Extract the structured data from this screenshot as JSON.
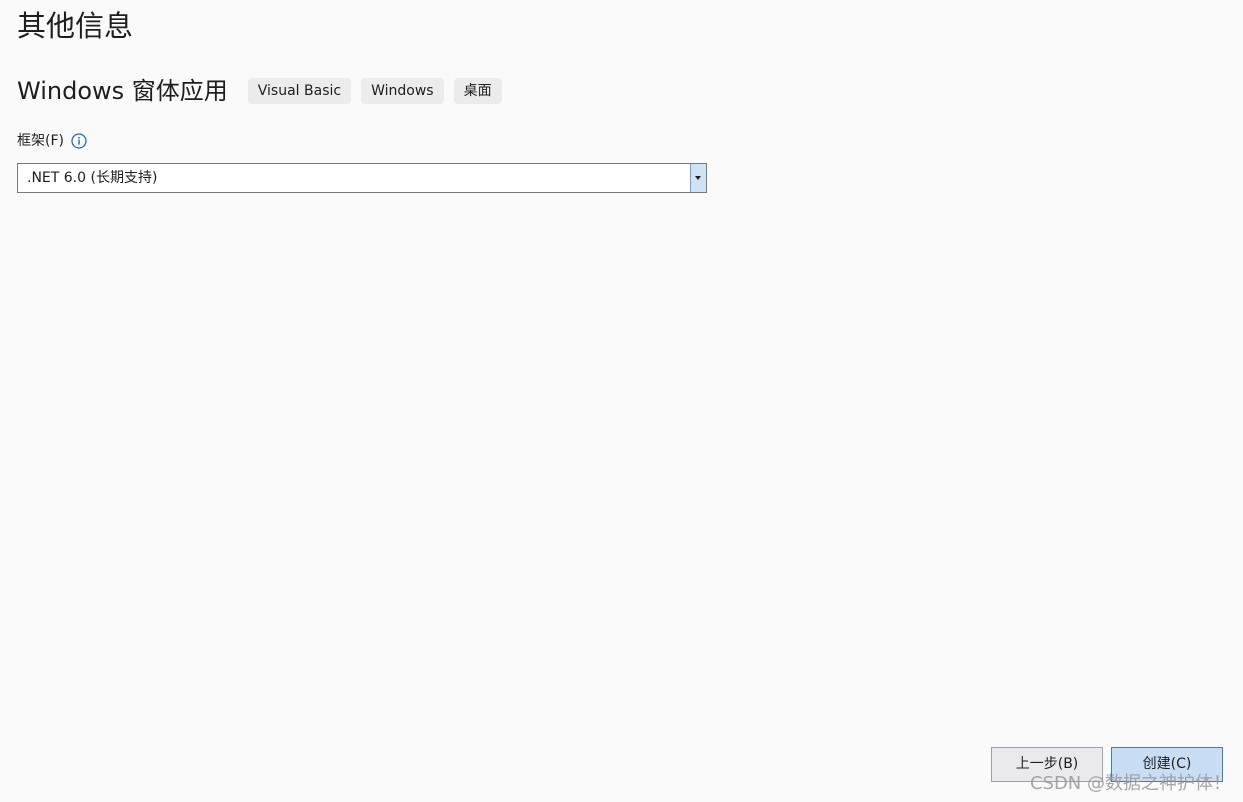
{
  "header": {
    "title": "其他信息"
  },
  "template": {
    "name": "Windows 窗体应用",
    "tags": [
      "Visual Basic",
      "Windows",
      "桌面"
    ]
  },
  "framework": {
    "label": "框架(F)",
    "info_icon": "info-circle-icon",
    "selected": ".NET 6.0 (长期支持)"
  },
  "footer": {
    "back_label": "上一步(B)",
    "create_label": "创建(C)"
  },
  "watermark": {
    "text": "CSDN @数据之神护体！"
  },
  "colors": {
    "background": "#fafafa",
    "info_icon": "#1f6fbf",
    "create_button": "#c9ddf4",
    "create_button_border": "#3c7fb1"
  }
}
